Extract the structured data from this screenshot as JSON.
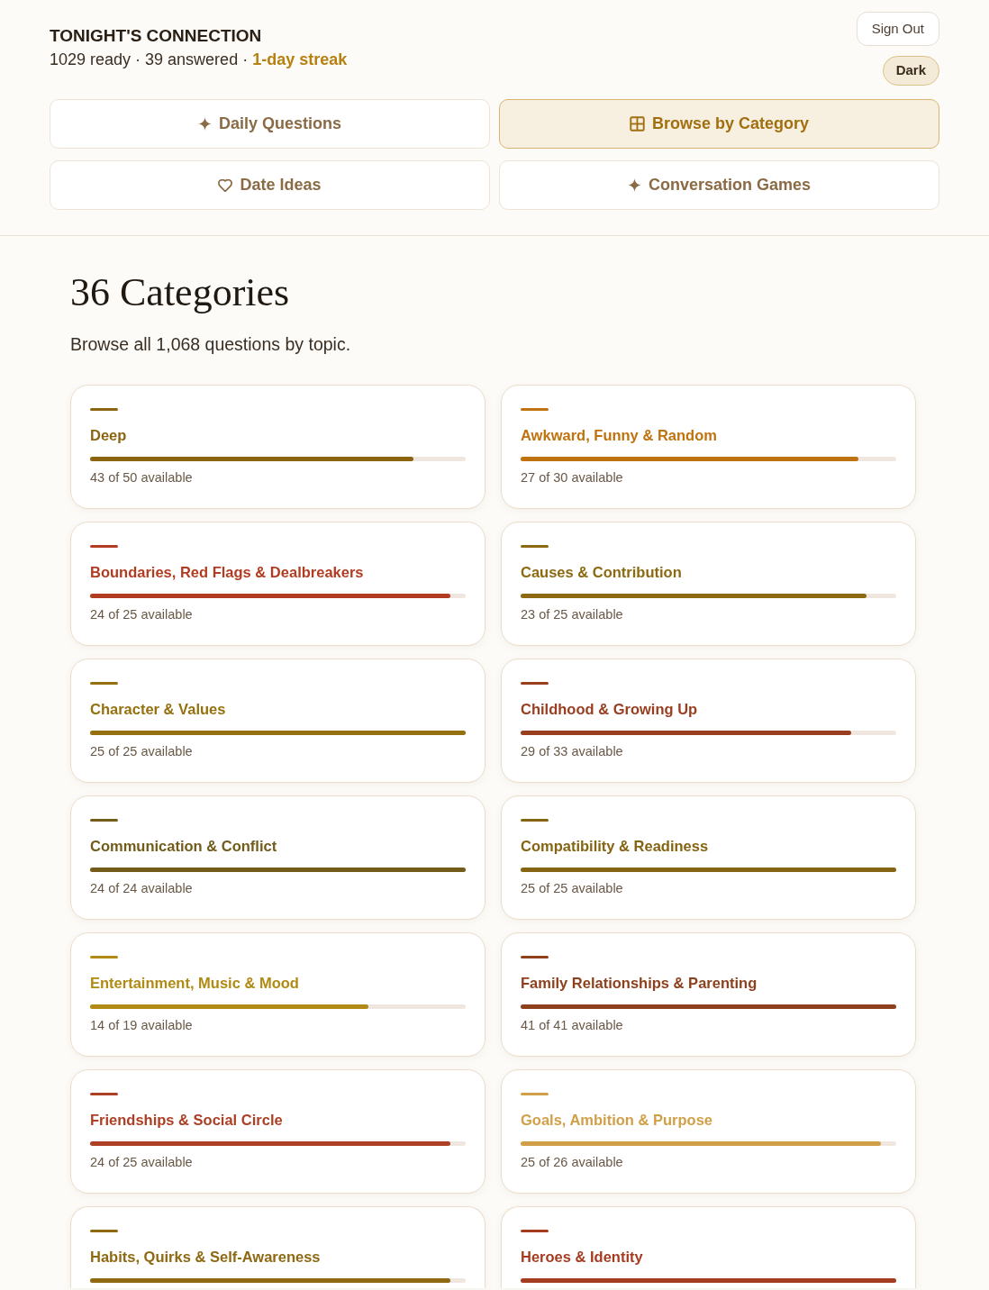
{
  "header": {
    "title": "TONIGHT'S CONNECTION",
    "stats": "1029 ready · 39 answered · **1-day streak**"
  },
  "actions": {
    "sign_out": "Sign Out",
    "theme": "Dark"
  },
  "nav_tabs": [
    {
      "label": "Daily Questions",
      "selected": false
    },
    {
      "label": "Browse by Category",
      "selected": true
    },
    {
      "label": "Date Ideas",
      "selected": false
    },
    {
      "label": "Conversation Games",
      "selected": false
    }
  ],
  "section": {
    "heading": "36 Categories",
    "subtitle": "Browse all 1,068 questions by topic."
  },
  "categories": [
    {
      "name": "Deep",
      "color": "#8b6410",
      "level": 0.86,
      "available": "43 of 50 available"
    },
    {
      "name": "Awkward, Funny & Random",
      "color": "#c0720e",
      "level": 0.9,
      "available": "27 of 30 available"
    },
    {
      "name": "Boundaries, Red Flags & Dealbreakers",
      "color": "#b23c22",
      "level": 0.96,
      "available": "24 of 25 available"
    },
    {
      "name": "Causes & Contribution",
      "color": "#8c6a12",
      "level": 0.92,
      "available": "23 of 25 available"
    },
    {
      "name": "Character & Values",
      "color": "#94700f",
      "level": 1,
      "available": "25 of 25 available"
    },
    {
      "name": "Childhood & Growing Up",
      "color": "#9a3e20",
      "level": 0.88,
      "available": "29 of 33 available"
    },
    {
      "name": "Communication & Conflict",
      "color": "#735c1a",
      "level": 1,
      "available": "24 of 24 available"
    },
    {
      "name": "Compatibility & Readiness",
      "color": "#866512",
      "level": 1,
      "available": "25 of 25 available"
    },
    {
      "name": "Entertainment, Music & Mood",
      "color": "#b08a12",
      "level": 0.74,
      "available": "14 of 19 available"
    },
    {
      "name": "Family Relationships & Parenting",
      "color": "#8e401c",
      "level": 1,
      "available": "41 of 41 available"
    },
    {
      "name": "Friendships & Social Circle",
      "color": "#ad3f24",
      "level": 0.96,
      "available": "24 of 25 available"
    },
    {
      "name": "Goals, Ambition & Purpose",
      "color": "#d19f47",
      "level": 0.96,
      "available": "25 of 26 available"
    },
    {
      "name": "Habits, Quirks & Self-Awareness",
      "color": "#8f6912",
      "level": 0.96
    },
    {
      "name": "Heroes & Identity",
      "color": "#a63c1f",
      "level": 1
    }
  ]
}
